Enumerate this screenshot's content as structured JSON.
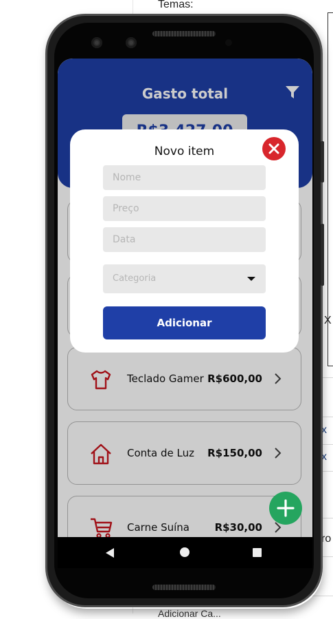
{
  "background_page": {
    "label": "Temas:",
    "fragments": [
      "X",
      "x",
      "x",
      "ro"
    ],
    "bottom_text": "Adicionar Ca..."
  },
  "header": {
    "title": "Gasto total",
    "total": "R$3.427,00",
    "filter_icon": "filter-icon",
    "color": "#1f3fa7"
  },
  "expenses": [
    {
      "name": "Teclado Gamer",
      "price": "R$600,00",
      "icon": "shirt-icon"
    },
    {
      "name": "Conta de Luz",
      "price": "R$150,00",
      "icon": "home-icon"
    },
    {
      "name": "Carne Suína",
      "price": "R$30,00",
      "icon": "cart-icon"
    }
  ],
  "modal": {
    "title": "Novo item",
    "close_icon": "close-icon",
    "fields": {
      "name_placeholder": "Nome",
      "price_placeholder": "Preço",
      "date_placeholder": "Data"
    },
    "category_placeholder": "Categoria",
    "submit_label": "Adicionar"
  },
  "fab_icon": "plus-icon",
  "nav": [
    "back-icon",
    "home-icon",
    "recents-icon"
  ],
  "colors": {
    "primary": "#1f3fa7",
    "danger": "#d8262c",
    "success": "#25a55f",
    "icon_red": "#c8161e"
  }
}
